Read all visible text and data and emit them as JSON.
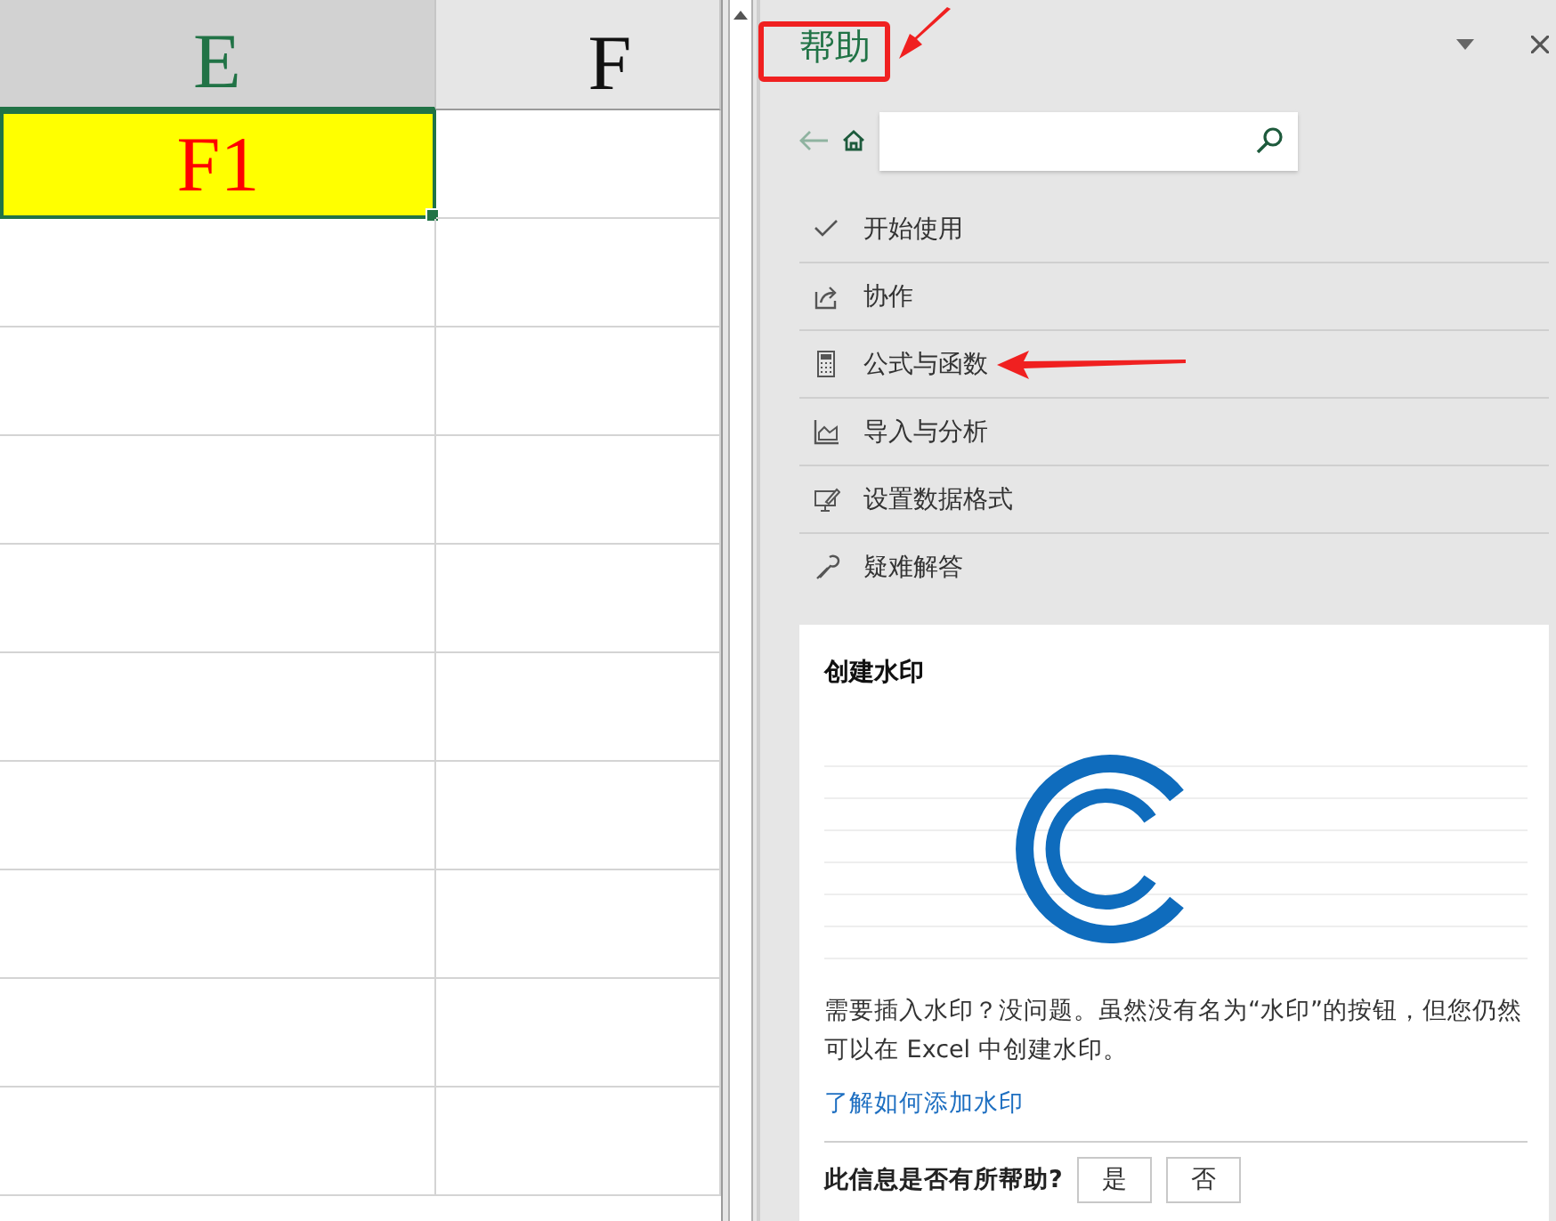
{
  "sheet": {
    "columns": [
      {
        "label": "E",
        "selected": true
      },
      {
        "label": "F",
        "selected": false
      }
    ],
    "cells": [
      {
        "text": "F1",
        "selected": true
      }
    ]
  },
  "help_pane": {
    "title": "帮助",
    "menu_items": [
      {
        "label": "开始使用"
      },
      {
        "label": "协作"
      },
      {
        "label": "公式与函数"
      },
      {
        "label": "导入与分析"
      },
      {
        "label": "设置数据格式"
      },
      {
        "label": "疑难解答"
      }
    ],
    "card": {
      "title": "创建水印",
      "body": "需要插入水印？没问题。虽然没有名为“水印”的按钮，但您仍然可以在 Excel 中创建水印。",
      "link": "了解如何添加水印",
      "feedback": {
        "question": "此信息是否有所帮助?",
        "buttons": [
          "是",
          "否"
        ]
      }
    }
  }
}
